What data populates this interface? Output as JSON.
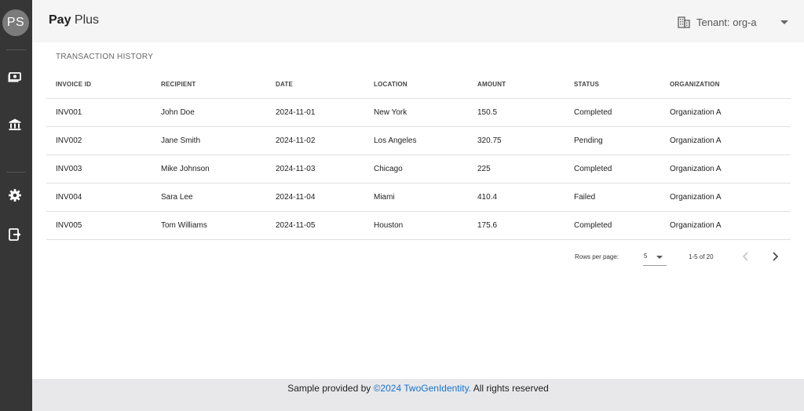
{
  "sidebar": {
    "avatar_initials": "PS",
    "items": [
      {
        "icon": "money-icon"
      },
      {
        "icon": "bank-icon"
      },
      {
        "icon": "gear-icon"
      },
      {
        "icon": "logout-icon"
      }
    ]
  },
  "header": {
    "brand_bold": "Pay",
    "brand_rest": "Plus",
    "tenant_label": "Tenant: org-a"
  },
  "main": {
    "section_title": "TRANSACTION HISTORY",
    "table": {
      "columns": [
        "INVOICE ID",
        "RECIPIENT",
        "DATE",
        "LOCATION",
        "AMOUNT",
        "STATUS",
        "ORGANIZATION"
      ],
      "rows": [
        [
          "INV001",
          "John Doe",
          "2024-11-01",
          "New York",
          "150.5",
          "Completed",
          "Organization A"
        ],
        [
          "INV002",
          "Jane Smith",
          "2024-11-02",
          "Los Angeles",
          "320.75",
          "Pending",
          "Organization A"
        ],
        [
          "INV003",
          "Mike Johnson",
          "2024-11-03",
          "Chicago",
          "225",
          "Completed",
          "Organization A"
        ],
        [
          "INV004",
          "Sara Lee",
          "2024-11-04",
          "Miami",
          "410.4",
          "Failed",
          "Organization A"
        ],
        [
          "INV005",
          "Tom Williams",
          "2024-11-05",
          "Houston",
          "175.6",
          "Completed",
          "Organization A"
        ]
      ]
    },
    "pagination": {
      "rows_per_page_label": "Rows per page:",
      "rows_per_page_value": "5",
      "range_text": "1-5 of 20"
    }
  },
  "footer": {
    "prefix": "Sample provided by ",
    "link_text": "©2024 TwoGenIdentity.",
    "suffix": " All rights reserved"
  },
  "colors": {
    "sidebar_bg": "#363636",
    "header_bg": "#f5f5f5",
    "footer_bg": "#e8e8ea",
    "link": "#1a73c8"
  }
}
